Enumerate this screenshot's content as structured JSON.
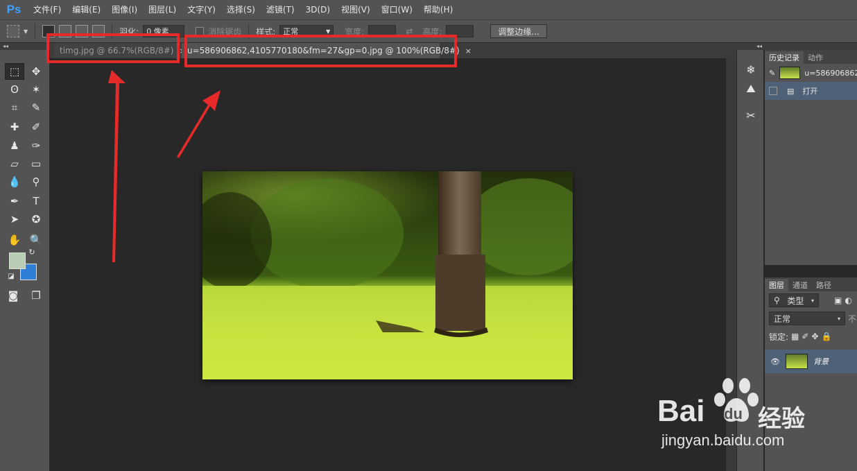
{
  "app": {
    "logo": "Ps"
  },
  "menu": [
    "文件(F)",
    "编辑(E)",
    "图像(I)",
    "图层(L)",
    "文字(Y)",
    "选择(S)",
    "滤镜(T)",
    "3D(D)",
    "视图(V)",
    "窗口(W)",
    "帮助(H)"
  ],
  "options": {
    "feather_label": "羽化:",
    "feather_value": "0 像素",
    "antialias_label": "消除锯齿",
    "style_label": "样式:",
    "style_value": "正常",
    "width_label": "宽度:",
    "height_label": "高度:",
    "refine_edge_button": "调整边缘..."
  },
  "tabs": [
    {
      "title": "timg.jpg @ 66.7%(RGB/8#)",
      "close": "×"
    },
    {
      "title": "u=586906862,4105770180&fm=27&gp=0.jpg @ 100%(RGB/8#)",
      "close": "×"
    }
  ],
  "history_panel": {
    "tabs": [
      "历史记录",
      "动作"
    ],
    "snapshot_label": "u=586906862",
    "open_step": "打开"
  },
  "layers_panel": {
    "tabs": [
      "图层",
      "通道",
      "路径"
    ],
    "filter_label": "类型",
    "blend_mode": "正常",
    "opacity_label": "不",
    "lock_label": "锁定:",
    "layer_name": "背景"
  },
  "watermark": {
    "brand": "Bai",
    "brand_du": "du",
    "brand_cn": "经验",
    "url": "jingyan.baidu.com"
  },
  "colors": {
    "foreground": "#b7cdb4",
    "background": "#2f7fd7",
    "annotation": "#e62a2a"
  }
}
